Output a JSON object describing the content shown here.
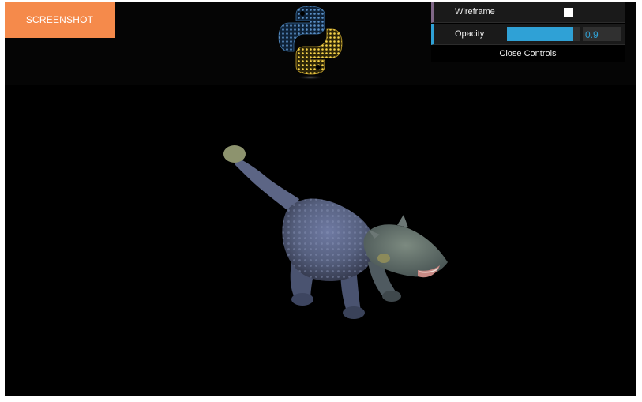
{
  "toolbar": {
    "screenshot_label": "SCREENSHOT"
  },
  "logo": {
    "icon": "python-logo-icon",
    "colors": {
      "blue": "#3b6fa0",
      "yellow": "#f3cf3f"
    }
  },
  "controls": {
    "wireframe": {
      "label": "Wireframe",
      "checked": false
    },
    "opacity": {
      "label": "Opacity",
      "value": "0.9",
      "fraction": 0.9
    },
    "close_label": "Close Controls",
    "accent_colors": {
      "wireframe": "#806787",
      "opacity": "#2fa1d6"
    }
  },
  "scene": {
    "model": "ankylosaurus-model",
    "background": "#000000"
  }
}
